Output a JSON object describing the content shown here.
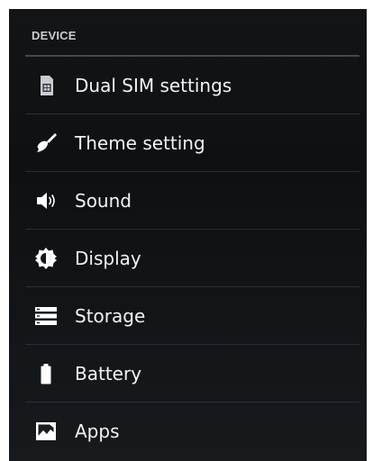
{
  "section": {
    "title": "DEVICE"
  },
  "items": [
    {
      "label": "Dual SIM settings",
      "icon": "sim-card-icon"
    },
    {
      "label": "Theme setting",
      "icon": "paintbrush-icon"
    },
    {
      "label": "Sound",
      "icon": "speaker-icon"
    },
    {
      "label": "Display",
      "icon": "brightness-icon"
    },
    {
      "label": "Storage",
      "icon": "storage-icon"
    },
    {
      "label": "Battery",
      "icon": "battery-icon"
    },
    {
      "label": "Apps",
      "icon": "apps-icon"
    }
  ],
  "colors": {
    "background": "#121416",
    "text": "#f1f3f4",
    "header_text": "#c9cdd1",
    "divider": "#2b2f33",
    "icon": "#ffffff"
  }
}
